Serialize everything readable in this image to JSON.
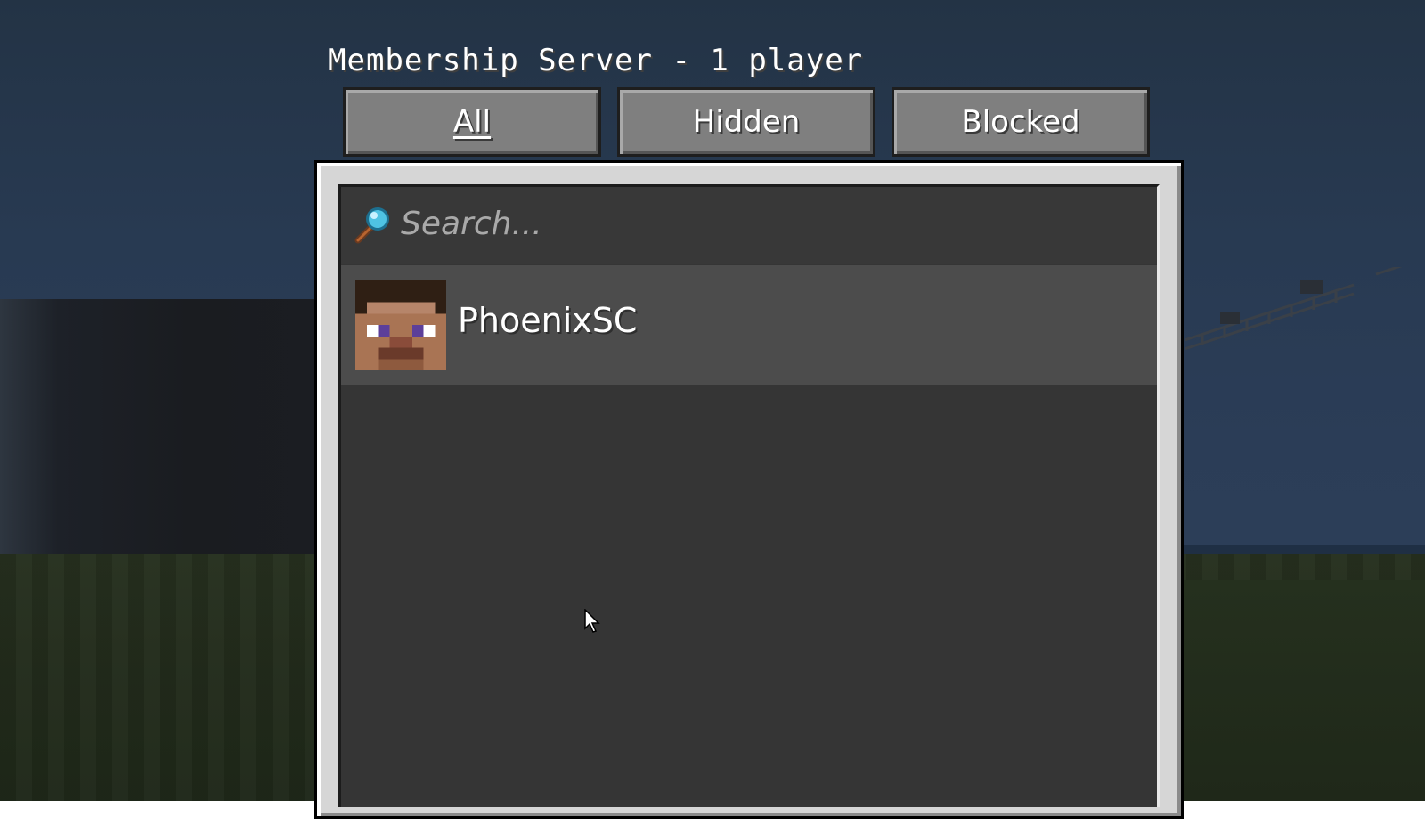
{
  "server": {
    "title": "Membership Server - 1 player"
  },
  "tabs": [
    {
      "label": "All",
      "selected": true
    },
    {
      "label": "Hidden",
      "selected": false
    },
    {
      "label": "Blocked",
      "selected": false
    }
  ],
  "search": {
    "placeholder": "Search...",
    "value": "",
    "icon": "magnifier-icon"
  },
  "players": [
    {
      "name": "PhoenixSC",
      "avatar": "steve-head-icon"
    }
  ],
  "colors": {
    "tab_bg": "#7f7f7f",
    "panel_frame": "#d6d6d6",
    "list_bg": "#353535",
    "row_bg": "#4c4c4c",
    "text": "#ffffff",
    "placeholder": "#a9a9a9"
  }
}
